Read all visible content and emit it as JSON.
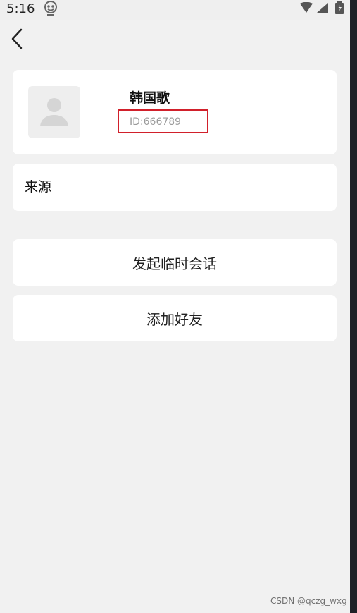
{
  "status_bar": {
    "time": "5:16",
    "icons": [
      "app-notification-icon",
      "wifi-icon",
      "signal-icon",
      "battery-icon"
    ]
  },
  "navigation": {
    "back_icon": "chevron-left-icon"
  },
  "profile": {
    "name": "韩国歌",
    "id_text": "ID:666789",
    "avatar_icon": "person-placeholder-icon"
  },
  "source": {
    "label": "来源"
  },
  "actions": {
    "start_temp_chat": "发起临时会话",
    "add_friend": "添加好友"
  },
  "watermark": "CSDN @qczg_wxg",
  "colors": {
    "background": "#f1f1f1",
    "card": "#ffffff",
    "highlight_border": "#d1202b",
    "id_text": "#9b9b9b"
  }
}
